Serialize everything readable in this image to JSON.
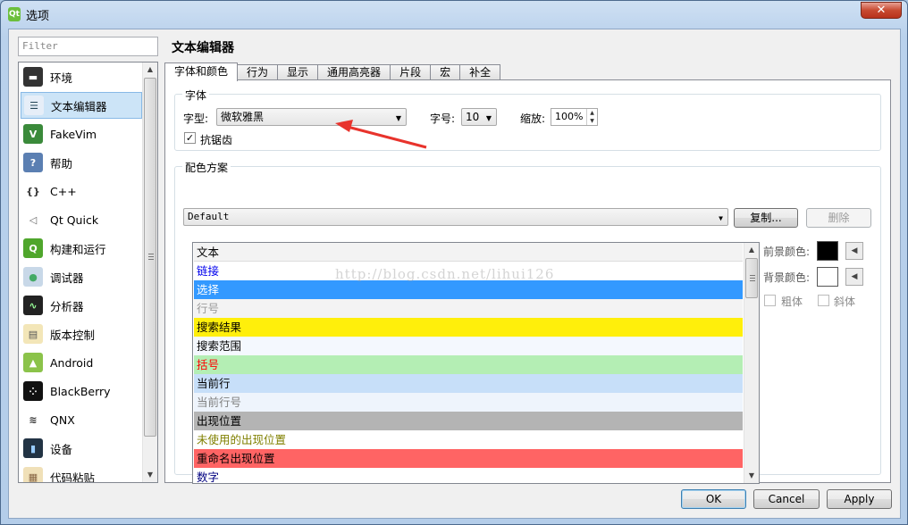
{
  "window": {
    "title": "选项",
    "app_icon_text": "Qt",
    "close_symbol": "✕"
  },
  "sidebar": {
    "filter_placeholder": "Filter",
    "items": [
      {
        "label": "环境",
        "icon": "environment-icon"
      },
      {
        "label": "文本编辑器",
        "icon": "text-editor-icon",
        "selected": true
      },
      {
        "label": "FakeVim",
        "icon": "fakevim-icon"
      },
      {
        "label": "帮助",
        "icon": "help-icon"
      },
      {
        "label": "C++",
        "icon": "cpp-icon"
      },
      {
        "label": "Qt Quick",
        "icon": "qt-quick-icon"
      },
      {
        "label": "构建和运行",
        "icon": "build-run-icon"
      },
      {
        "label": "调试器",
        "icon": "debugger-icon"
      },
      {
        "label": "分析器",
        "icon": "analyzer-icon"
      },
      {
        "label": "版本控制",
        "icon": "version-control-icon"
      },
      {
        "label": "Android",
        "icon": "android-icon"
      },
      {
        "label": "BlackBerry",
        "icon": "blackberry-icon"
      },
      {
        "label": "QNX",
        "icon": "qnx-icon"
      },
      {
        "label": "设备",
        "icon": "devices-icon"
      },
      {
        "label": "代码粘贴",
        "icon": "code-paste-icon"
      }
    ]
  },
  "main": {
    "page_title": "文本编辑器",
    "tabs": [
      "字体和颜色",
      "行为",
      "显示",
      "通用高亮器",
      "片段",
      "宏",
      "补全"
    ],
    "active_tab": 0,
    "font_group": {
      "title": "字体",
      "family_label": "字型:",
      "family_value": "微软雅黑",
      "size_label": "字号:",
      "size_value": "10",
      "zoom_label": "缩放:",
      "zoom_value": "100%",
      "antialias_label": "抗锯齿",
      "antialias_checked": true
    },
    "scheme_group": {
      "title": "配色方案",
      "scheme_value": "Default",
      "copy_button": "复制...",
      "delete_button": "删除",
      "items": [
        {
          "label": "文本",
          "fg": "#000000",
          "bg": "#f3f3f3"
        },
        {
          "label": "链接",
          "fg": "#0000ee",
          "bg": "#ffffff"
        },
        {
          "label": "选择",
          "fg": "#ffffff",
          "bg": "#3399ff"
        },
        {
          "label": "行号",
          "fg": "#9a9a9a",
          "bg": "#f3f3f3"
        },
        {
          "label": "搜索结果",
          "fg": "#000000",
          "bg": "#ffef0b"
        },
        {
          "label": "搜索范围",
          "fg": "#000000",
          "bg": "#f4f8fe"
        },
        {
          "label": "括号",
          "fg": "#ff0000",
          "bg": "#b4eeb4"
        },
        {
          "label": "当前行",
          "fg": "#000000",
          "bg": "#c7dff9"
        },
        {
          "label": "当前行号",
          "fg": "#808080",
          "bg": "#eef4fc"
        },
        {
          "label": "出现位置",
          "fg": "#000000",
          "bg": "#b4b4b4"
        },
        {
          "label": "未使用的出现位置",
          "fg": "#808000",
          "bg": "#ffffff"
        },
        {
          "label": "重命名出现位置",
          "fg": "#000000",
          "bg": "#ff6464"
        },
        {
          "label": "数字",
          "fg": "#000080",
          "bg": "#ffffff"
        }
      ],
      "foreground_label": "前景颜色:",
      "foreground_color": "#000000",
      "background_label": "背景颜色:",
      "background_color": "#ffffff",
      "bold_label": "粗体",
      "italic_label": "斜体"
    }
  },
  "buttons": {
    "ok": "OK",
    "cancel": "Cancel",
    "apply": "Apply"
  },
  "watermark": "http://blog.csdn.net/lihui126"
}
